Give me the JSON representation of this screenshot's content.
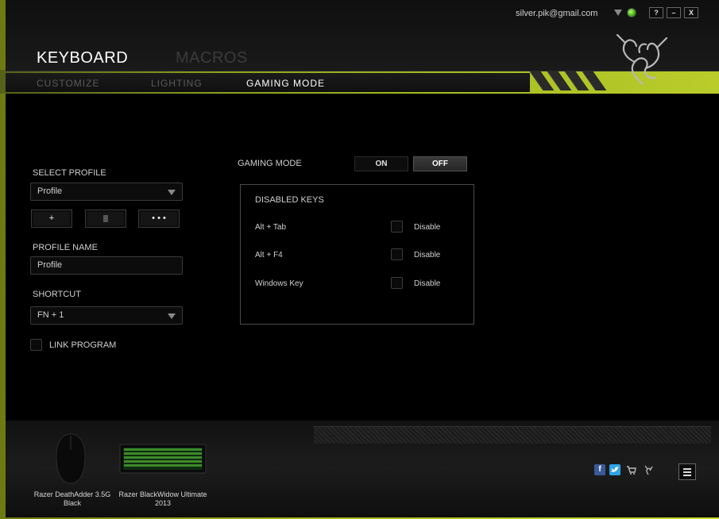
{
  "header": {
    "user_email": "silver.pik@gmail.com",
    "window_buttons": {
      "help": "?",
      "minimize": "–",
      "close": "X"
    },
    "main_tabs": [
      {
        "label": "KEYBOARD",
        "active": true
      },
      {
        "label": "MACROS",
        "active": false
      }
    ],
    "sub_tabs": [
      {
        "label": "CUSTOMIZE",
        "active": false
      },
      {
        "label": "LIGHTING",
        "active": false
      },
      {
        "label": "GAMING MODE",
        "active": true
      }
    ]
  },
  "left_panel": {
    "select_profile_label": "SELECT PROFILE",
    "profile_select_value": "Profile",
    "add_button": "+",
    "more_button": "• • •",
    "profile_name_label": "PROFILE NAME",
    "profile_name_value": "Profile",
    "shortcut_label": "SHORTCUT",
    "shortcut_value": "FN + 1",
    "link_program_label": "LINK PROGRAM"
  },
  "gaming_mode": {
    "label": "GAMING MODE",
    "on_label": "ON",
    "off_label": "OFF",
    "state": "OFF",
    "disabled_keys": {
      "title": "DISABLED KEYS",
      "rows": [
        {
          "key": "Alt + Tab",
          "checkbox_label": "Disable",
          "checked": false
        },
        {
          "key": "Alt + F4",
          "checkbox_label": "Disable",
          "checked": false
        },
        {
          "key": "Windows Key",
          "checkbox_label": "Disable",
          "checked": false
        }
      ]
    }
  },
  "footer": {
    "devices": [
      {
        "name": "Razer DeathAdder 3.5G Black",
        "line1": "Razer DeathAdder 3.5G",
        "line2": "Black"
      },
      {
        "name": "Razer BlackWidow Ultimate 2013",
        "line1": "Razer BlackWidow Ultimate",
        "line2": "2013"
      }
    ],
    "social_icons": [
      "facebook-icon",
      "twitter-icon",
      "cart-icon",
      "razer-icon"
    ]
  },
  "colors": {
    "accent_lime": "#a6bc22",
    "status_green": "#44c814",
    "facebook_blue": "#3b5998",
    "twitter_blue": "#2ea3e6"
  }
}
